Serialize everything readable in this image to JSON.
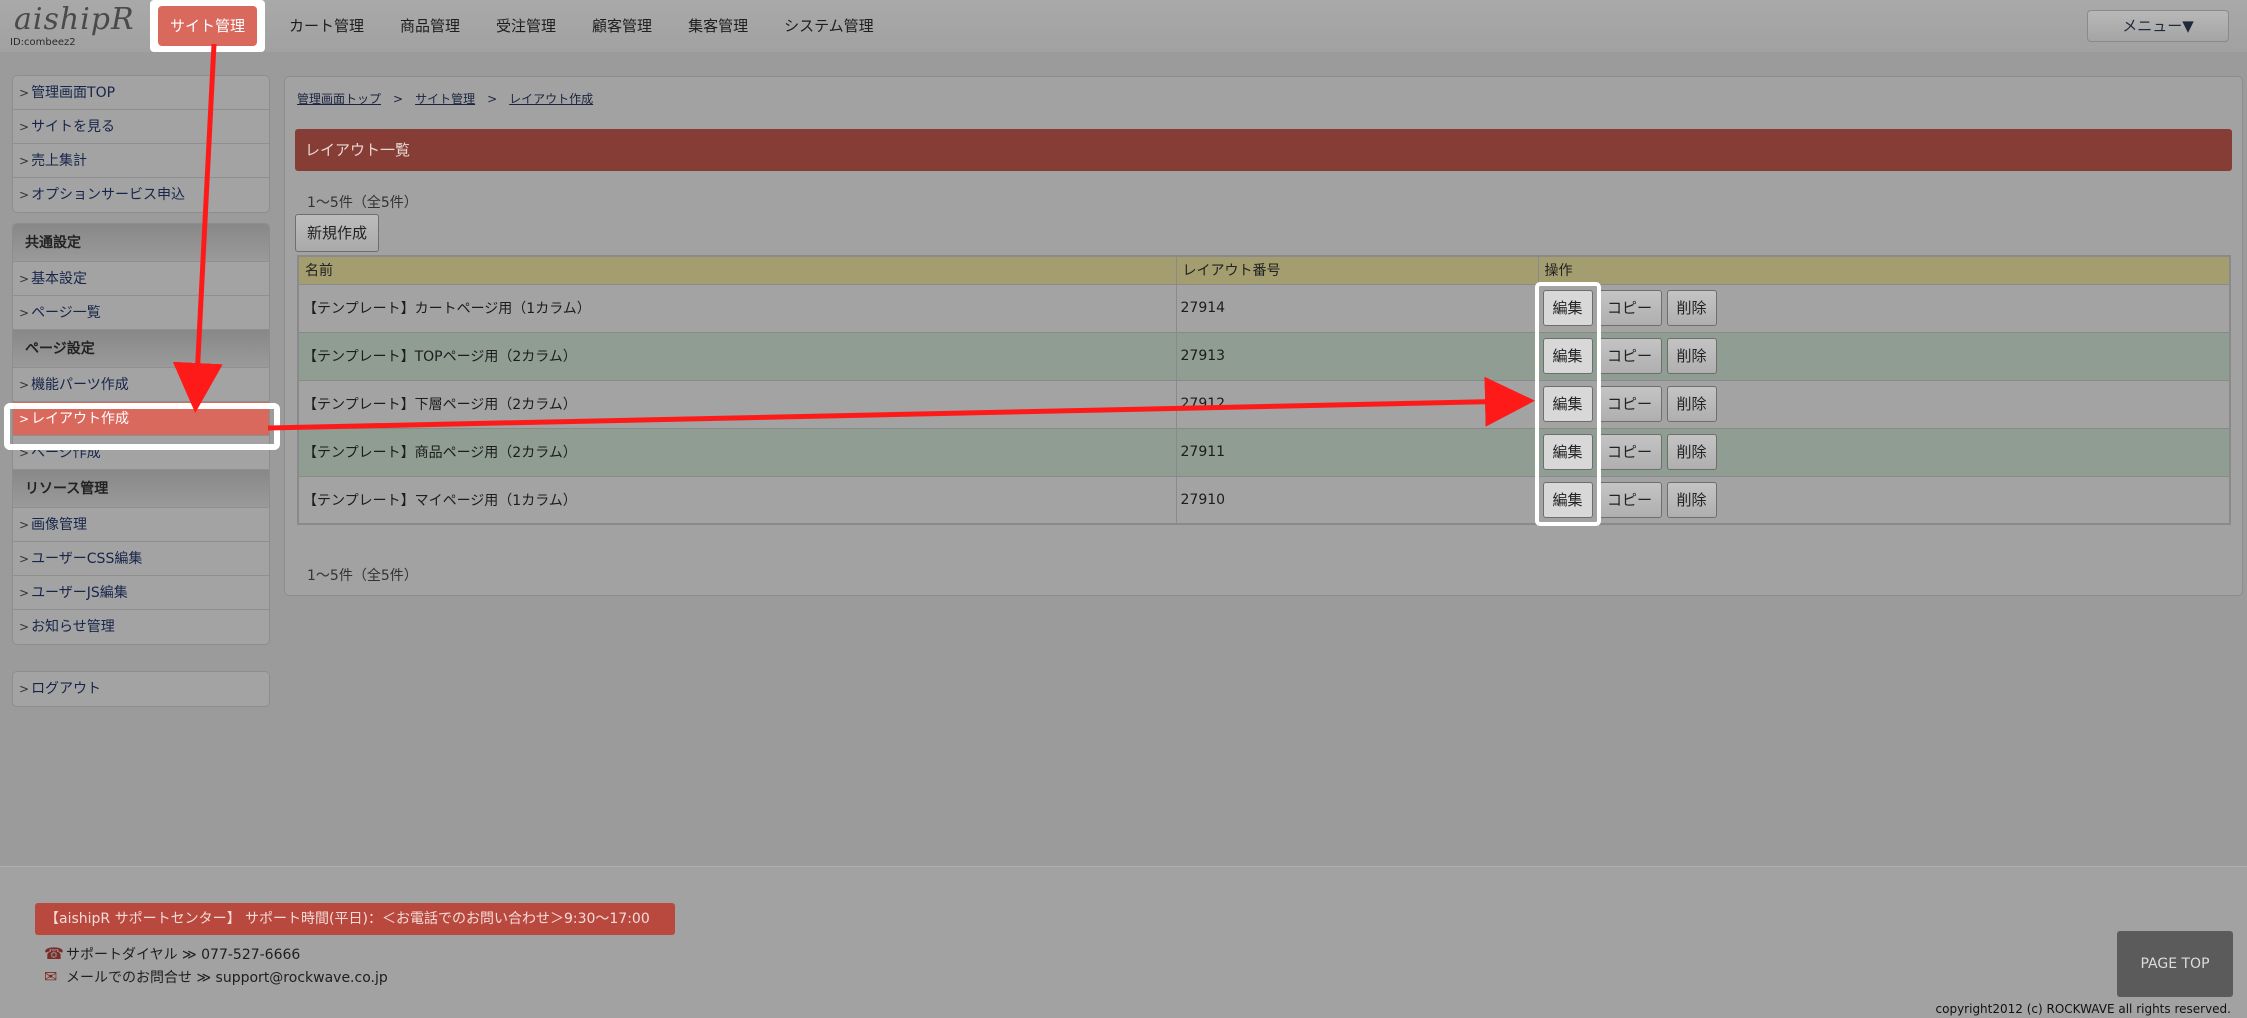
{
  "header": {
    "logo": "aishipR",
    "id_label": "ID:combeez2",
    "nav": [
      "サイト管理",
      "カート管理",
      "商品管理",
      "受注管理",
      "顧客管理",
      "集客管理",
      "システム管理"
    ],
    "menu_button": "メニュー▼"
  },
  "sidebar": {
    "top_links": [
      "管理画面TOP",
      "サイトを見る",
      "売上集計",
      "オプションサービス申込"
    ],
    "sections": [
      {
        "heading": "共通設定",
        "links": [
          "基本設定",
          "ページ一覧"
        ]
      },
      {
        "heading": "ページ設定",
        "links": [
          "機能パーツ作成",
          "レイアウト作成",
          "ページ作成"
        ]
      },
      {
        "heading": "リソース管理",
        "links": [
          "画像管理",
          "ユーザーCSS編集",
          "ユーザーJS編集",
          "お知らせ管理"
        ]
      }
    ],
    "logout": "ログアウト"
  },
  "main": {
    "breadcrumb": [
      "管理画面トップ",
      "サイト管理",
      "レイアウト作成"
    ],
    "breadcrumb_sep": ">",
    "title": "レイアウト一覧",
    "count_top": "1～5件（全5件）",
    "count_bottom": "1～5件（全5件）",
    "new_button": "新規作成",
    "table": {
      "headers": [
        "名前",
        "レイアウト番号",
        "操作"
      ],
      "rows": [
        {
          "name": "【テンプレート】カートページ用（1カラム）",
          "number": "27914"
        },
        {
          "name": "【テンプレート】TOPページ用（2カラム）",
          "number": "27913"
        },
        {
          "name": "【テンプレート】下層ページ用（2カラム）",
          "number": "27912"
        },
        {
          "name": "【テンプレート】商品ページ用（2カラム）",
          "number": "27911"
        },
        {
          "name": "【テンプレート】マイページ用（1カラム）",
          "number": "27910"
        }
      ],
      "op_labels": {
        "edit": "編集",
        "copy": "コピー",
        "delete": "削除"
      }
    }
  },
  "footer": {
    "support_bar": "【aishipR サポートセンター】 サポート時間(平日)：＜お電話でのお問い合わせ＞9:30～17:00",
    "phone_label": "サポートダイヤル ≫ 077-527-6666",
    "mail_label": "メールでのお問合せ ≫ support@rockwave.co.jp",
    "page_top": "PAGE TOP",
    "copyright": "copyright2012 (c) ROCKWAVE  all rights reserved."
  },
  "colors": {
    "accent": "#d9685d",
    "title_bar": "#863d35",
    "table_header": "#a49d70",
    "arrow": "#ff1a1a"
  }
}
